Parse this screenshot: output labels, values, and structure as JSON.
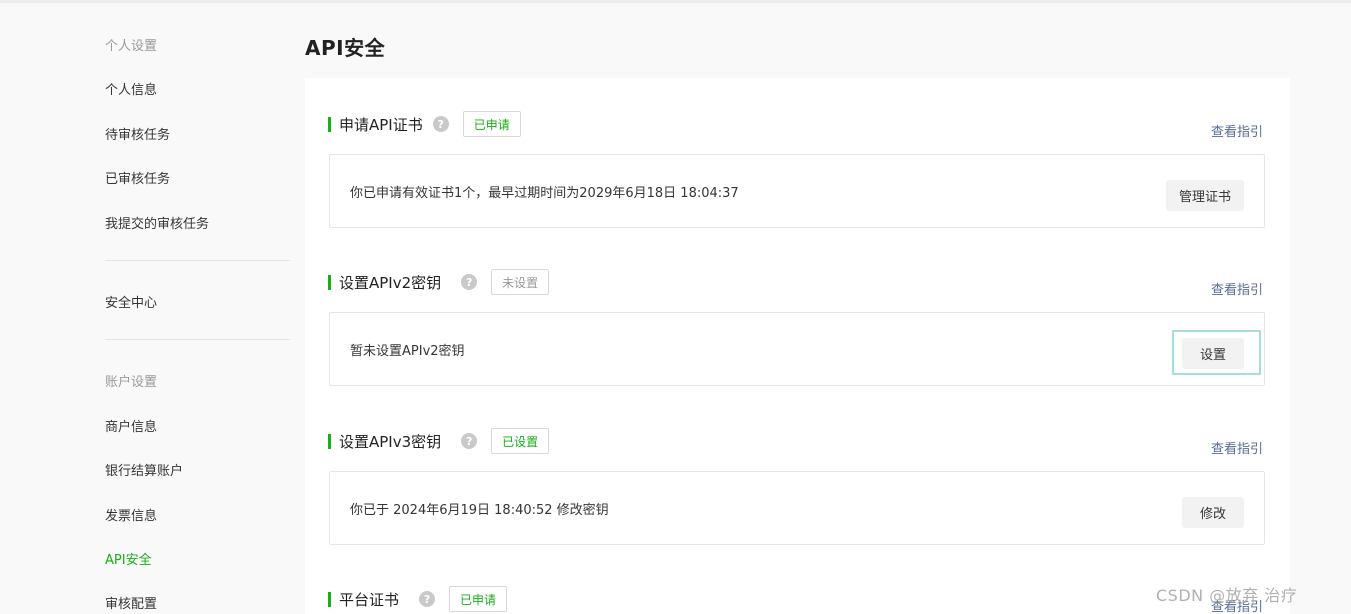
{
  "sidebar": {
    "group_personal": "个人设置",
    "personal_items": [
      "个人信息",
      "待审核任务",
      "已审核任务",
      "我提交的审核任务"
    ],
    "security_center": "安全中心",
    "group_account": "账户设置",
    "account_items": [
      "商户信息",
      "银行结算账户",
      "发票信息",
      "API安全",
      "审核配置"
    ],
    "active_item": "API安全"
  },
  "page": {
    "title": "API安全"
  },
  "sections": [
    {
      "title": "申请API证书",
      "help": "?",
      "status": "已申请",
      "guide": "查看指引",
      "text": "你已申请有效证书1个，最早过期时间为2029年6月18日 18:04:37",
      "button": "管理证书"
    },
    {
      "title": "设置APIv2密钥",
      "help": "?",
      "status": "未设置",
      "guide": "查看指引",
      "text": "暂未设置APIv2密钥",
      "button": "设置"
    },
    {
      "title": "设置APIv3密钥",
      "help": "?",
      "status": "已设置",
      "guide": "查看指引",
      "text": "你已于 2024年6月19日 18:40:52 修改密钥",
      "button": "修改"
    },
    {
      "title": "平台证书",
      "help": "?",
      "status": "已申请",
      "guide": "查看指引"
    }
  ],
  "colors": {
    "accent": "#1aad19",
    "link": "#576b95",
    "muted": "#9a9a9a"
  },
  "watermark": "CSDN @放弃 治疗"
}
